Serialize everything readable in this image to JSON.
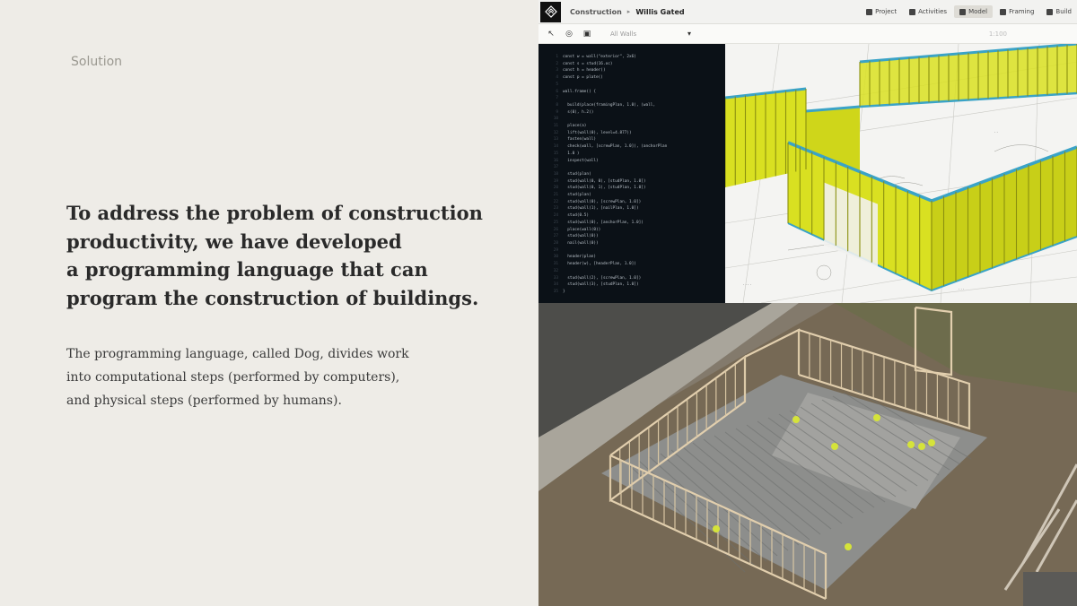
{
  "slide": {
    "section_label": "Solution",
    "headline_lines": [
      "To address the problem of construction",
      "productivity, we have developed",
      "a programming language that can",
      "program the construction of buildings."
    ],
    "body_lines": [
      "The programming language, called Dog, divides work",
      "into computational steps (performed by computers),",
      "and physical steps (performed by humans)."
    ]
  },
  "app": {
    "breadcrumb": {
      "section": "Construction",
      "project": "Willis Gated"
    },
    "tabs": [
      {
        "label": "Project",
        "icon": "folder-icon"
      },
      {
        "label": "Activities",
        "icon": "activity-icon"
      },
      {
        "label": "Model",
        "icon": "cube-icon",
        "active": true
      },
      {
        "label": "Framing",
        "icon": "frame-icon"
      },
      {
        "label": "Build",
        "icon": "hammer-icon"
      }
    ],
    "toolbar": {
      "tools": [
        "pointer-icon",
        "orbit-icon",
        "camera-icon"
      ],
      "select_value": "All Walls",
      "right_value": "1:100"
    },
    "code_lines": [
      "const w = wall(\"exterior\", 2x6)",
      "const s = stud(16.oc)",
      "const h = header()",
      "const p = plate()",
      "",
      "wall.frame() {",
      "",
      "  build(place(framingPlan, 1.0), (wall,",
      "  s(0), h.2))",
      "",
      "  place(a)",
      "  lift(wall(0), level=4.877))",
      "  fasten(wall)",
      "  check(wall, [screwPlan, 1.0]), (anchorPlan",
      "  1.0 )",
      "  inspect(wall)",
      "",
      "  stud(plan)",
      "  stud(wall(0, 0), [studPlan, 1.0])",
      "  stud(wall(0, 1), [studPlan, 1.0])",
      "  stud(plan)",
      "  stud(wall(0), [screwPlan, 1.0])",
      "  stud(wall(1), [nailPlan, 1.0])",
      "  stud(0.5)",
      "  stud(wall(0), [anchorPlan, 1.0])",
      "  place(wall(0))",
      "  stud(wall(0))",
      "  nail(wall(0))",
      "",
      "  header(plan)",
      "  header(w), [headerPlan, 1.0])",
      "",
      "  stud(wall(2), [screwPlan, 1.0])",
      "  stud(wall(3), [studPlan, 1.0])",
      "}"
    ]
  },
  "colors": {
    "background": "#eeece7",
    "framing_yellow": "#d9e021",
    "plate_blue": "#3aa3c7",
    "code_bg": "#0b1117"
  }
}
